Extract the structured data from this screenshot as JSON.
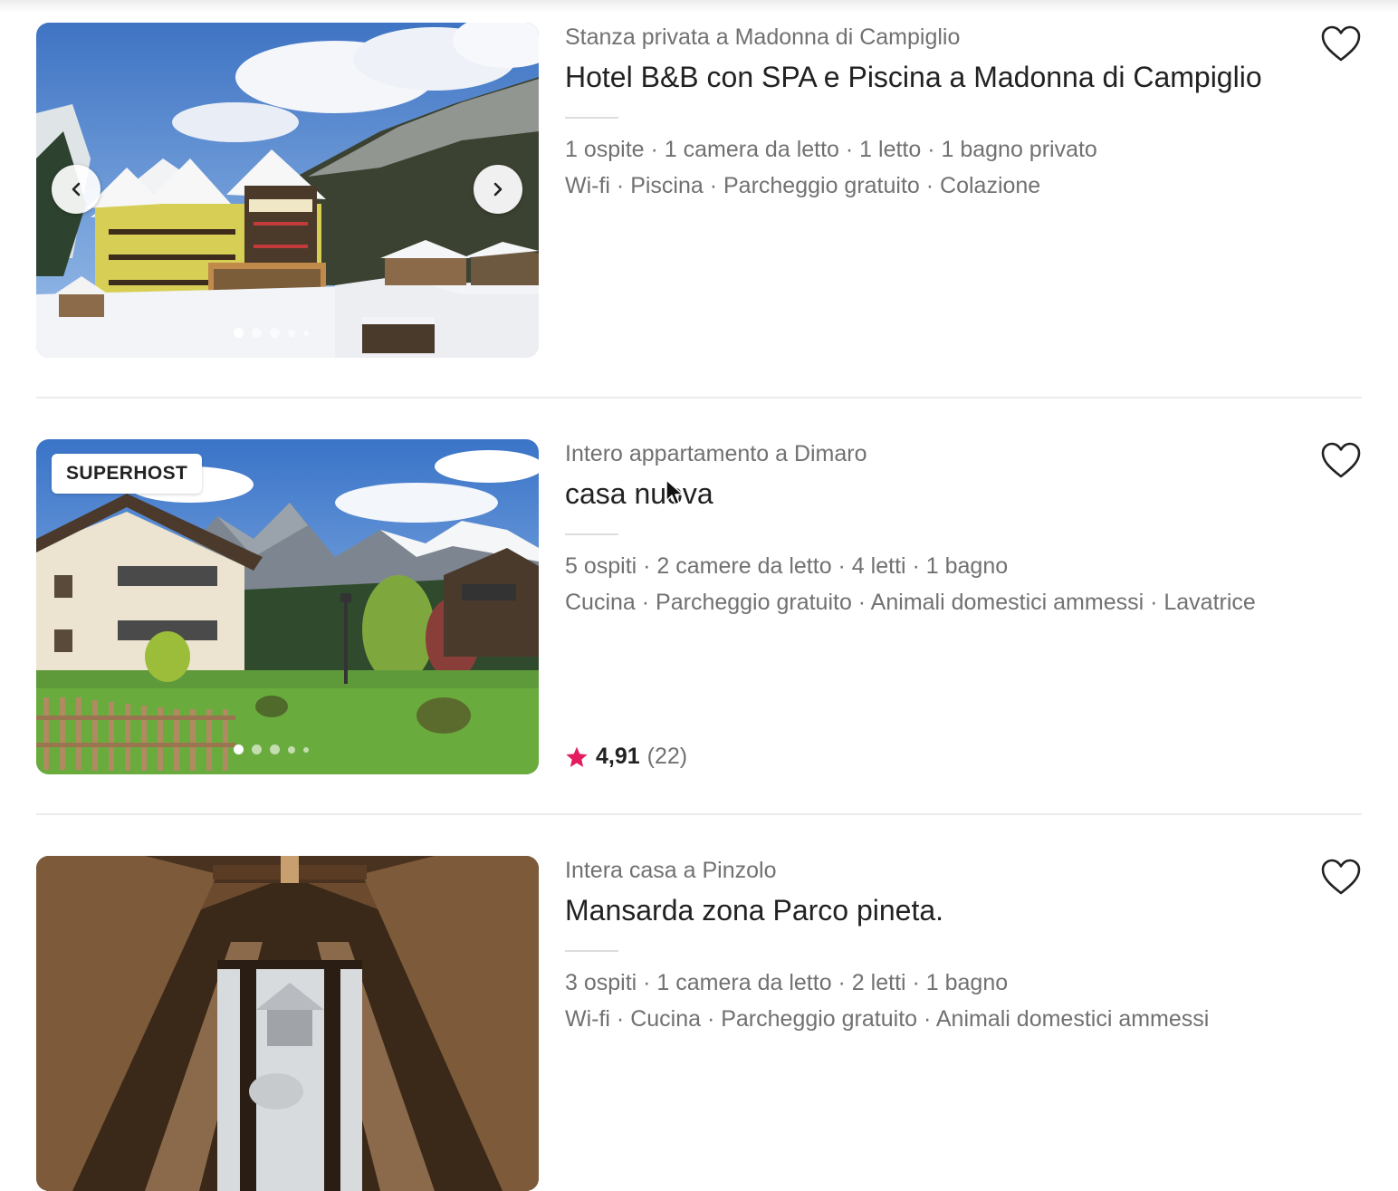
{
  "listings": [
    {
      "subtitle": "Stanza privata a Madonna di Campiglio",
      "title": "Hotel B&B con SPA e Piscina a Madonna di Campiglio",
      "details": "1 ospite · 1 camera da letto · 1 letto · 1 bagno privato",
      "amenities": "Wi-fi · Piscina · Parcheggio gratuito · Colazione",
      "photo_icon": "hotel-snow-photo",
      "favorite_icon": "heart-outline-icon"
    },
    {
      "badge": "SUPERHOST",
      "subtitle": "Intero appartamento a Dimaro",
      "title": "casa nuova",
      "details": "5 ospiti · 2 camere da letto · 4 letti · 1 bagno",
      "amenities": "Cucina · Parcheggio gratuito · Animali domestici ammessi · Lavatrice",
      "rating": "4,91",
      "reviews": "(22)",
      "photo_icon": "chalet-mountain-photo",
      "favorite_icon": "heart-outline-icon"
    },
    {
      "subtitle": "Intera casa a Pinzolo",
      "title": "Mansarda zona Parco pineta.",
      "details": "3 ospiti · 1 camera da letto · 2 letti · 1 bagno",
      "amenities": "Wi-fi · Cucina · Parcheggio gratuito · Animali domestici ammessi",
      "photo_icon": "attic-window-photo",
      "favorite_icon": "heart-outline-icon"
    }
  ],
  "colors": {
    "text_primary": "#222222",
    "text_secondary": "#717171",
    "star": "#E31C5F",
    "divider": "#EBEBEB"
  }
}
